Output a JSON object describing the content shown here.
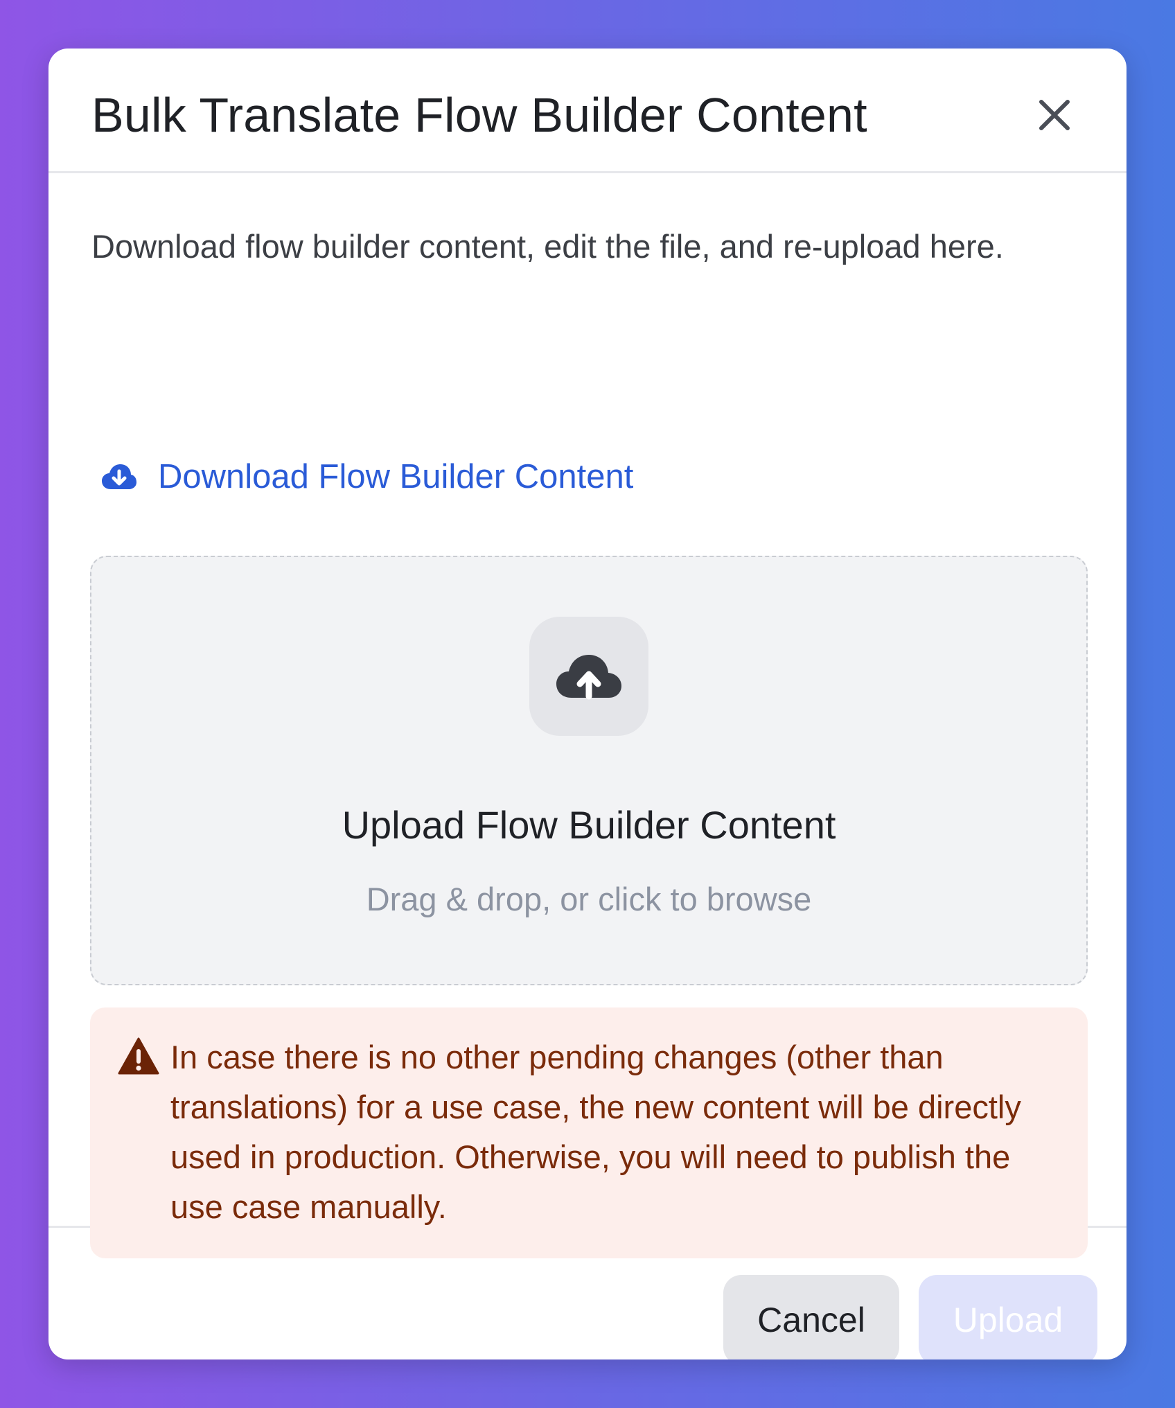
{
  "dialog": {
    "title": "Bulk Translate Flow Builder Content",
    "close_icon": "close-icon"
  },
  "body": {
    "description": "Download flow builder content, edit the file, and re-upload here.",
    "download_link": {
      "icon": "cloud-download-icon",
      "label": "Download Flow Builder Content",
      "color": "#2a5bd7"
    },
    "dropzone": {
      "icon": "cloud-upload-icon",
      "title": "Upload Flow Builder Content",
      "hint": "Drag & drop, or click to browse"
    },
    "warning": {
      "icon": "warning-triangle-icon",
      "text": "In case there is no other pending changes (other than translations) for a use case, the new content will be directly used in production. Otherwise, you will need to publish the use case manually.",
      "background": "#fdeeeb",
      "text_color": "#7a2b0a"
    }
  },
  "footer": {
    "cancel_label": "Cancel",
    "upload_label": "Upload",
    "upload_disabled": true
  }
}
